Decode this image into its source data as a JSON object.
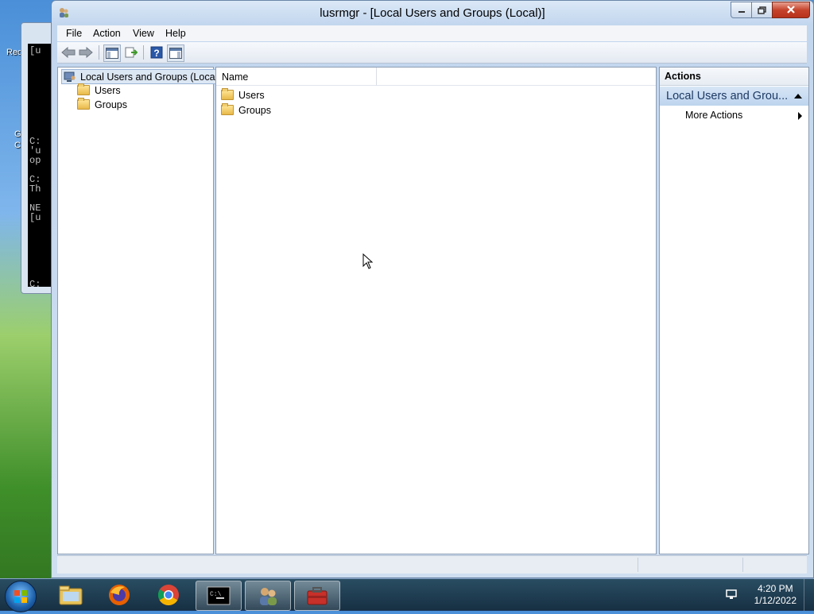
{
  "window": {
    "title": "lusrmgr - [Local Users and Groups (Local)]"
  },
  "menu": [
    "File",
    "Action",
    "View",
    "Help"
  ],
  "toolbar": {
    "icons": [
      "back-arrow-icon",
      "forward-arrow-icon",
      "show-hide-console-tree-icon",
      "export-list-icon",
      "help-icon",
      "show-hide-action-pane-icon"
    ]
  },
  "tree": {
    "root": "Local Users and Groups (Local)",
    "children": [
      "Users",
      "Groups"
    ]
  },
  "list": {
    "column_header": "Name",
    "items": [
      "Users",
      "Groups"
    ]
  },
  "actions": {
    "header": "Actions",
    "section_title": "Local Users and Grou...",
    "more_actions": "More Actions"
  },
  "desktop": {
    "console_lines": [
      "[u",
      "C:",
      "'u",
      "op",
      "C:",
      "Th",
      "NE",
      "[u",
      "C:",
      "C:"
    ],
    "icon_labels": [
      "Rec",
      "G",
      "C"
    ]
  },
  "taskbar": {
    "time": "4:20 PM",
    "date": "1/12/2022",
    "apps": [
      "file-explorer-icon",
      "firefox-icon",
      "chrome-icon",
      "command-prompt-icon",
      "users-management-icon",
      "toolbox-icon"
    ]
  },
  "colors": {
    "accent": "#1e3a64",
    "selection": "#dce7f4"
  }
}
